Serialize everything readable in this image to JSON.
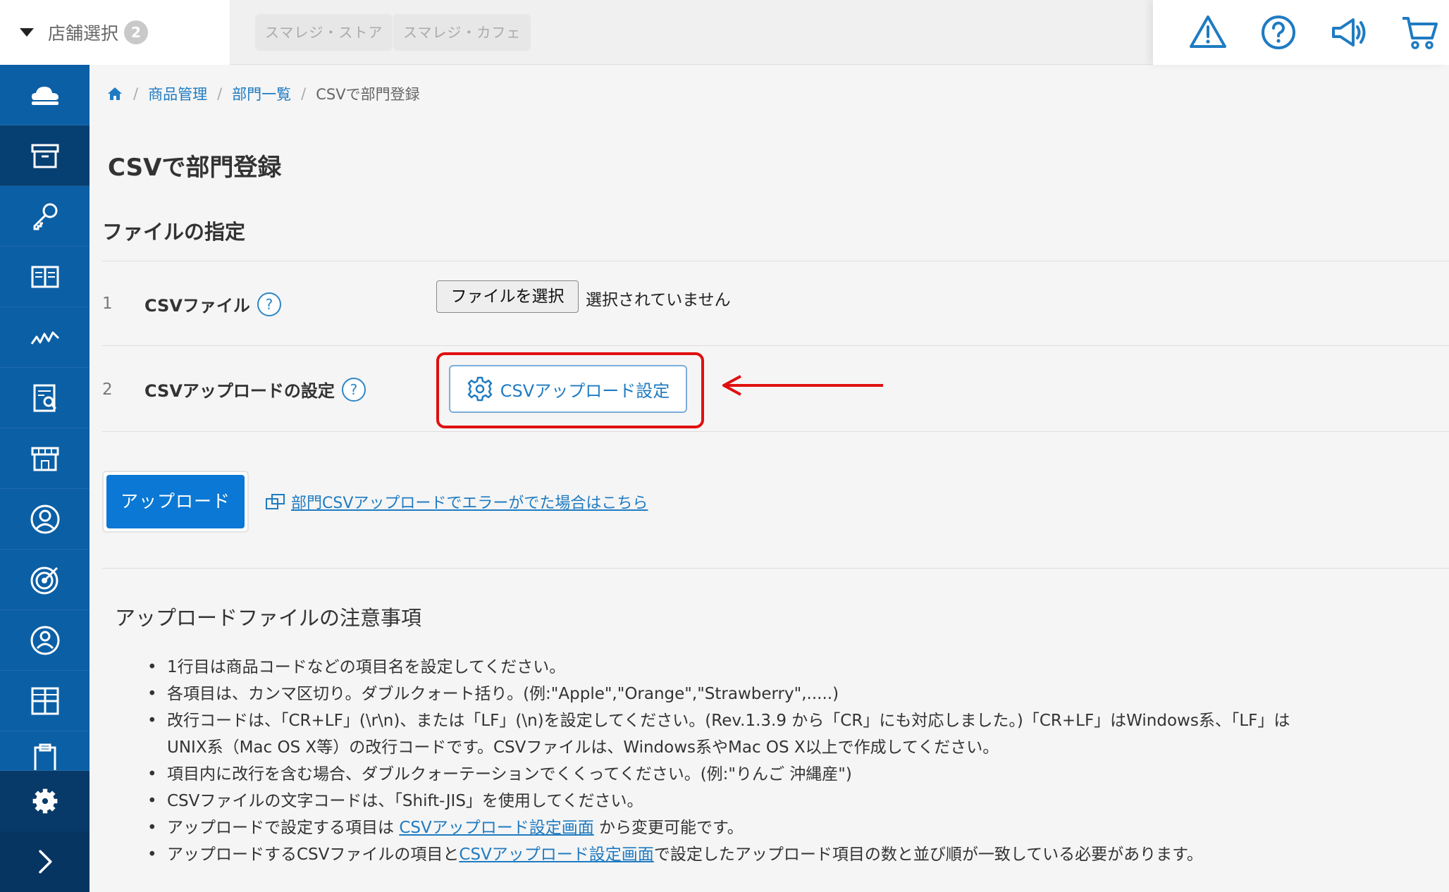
{
  "header": {
    "store_select_label": "店舗選択",
    "store_count": "2",
    "stores": [
      "スマレジ・ストア",
      "スマレジ・カフェ"
    ],
    "icons": [
      "warning-icon",
      "help-icon",
      "megaphone-icon",
      "cart-icon"
    ]
  },
  "sidebar": {
    "items": [
      "cloud-icon",
      "archive-icon",
      "key-icon",
      "book-icon",
      "chart-icon",
      "report-icon",
      "store-icon",
      "user-circle-icon",
      "target-icon",
      "person-icon",
      "grid-icon",
      "clipboard-icon"
    ],
    "active_index": 1,
    "bottom": [
      "gear-icon",
      "chevron-right-icon"
    ]
  },
  "breadcrumb": {
    "items": [
      "商品管理",
      "部門一覧"
    ],
    "current": "CSVで部門登録"
  },
  "page": {
    "title": "CSVで部門登録",
    "section_title": "ファイルの指定"
  },
  "form": {
    "rows": [
      {
        "number": "1",
        "label": "CSVファイル",
        "help": "?"
      },
      {
        "number": "2",
        "label": "CSVアップロードの設定",
        "help": "?"
      }
    ],
    "file_button": "ファイルを選択",
    "file_status": "選択されていません",
    "settings_button": "CSVアップロード設定"
  },
  "actions": {
    "upload_button": "アップロード",
    "error_link": "部門CSVアップロードでエラーがでた場合はこちら"
  },
  "notes": {
    "title": "アップロードファイルの注意事項",
    "items": [
      "1行目は商品コードなどの項目名を設定してください。",
      "各項目は、カンマ区切り。ダブルクォート括り。(例:\"Apple\",\"Orange\",\"Strawberry\",.....)",
      "改行コードは、「CR+LF」(\\r\\n)、または「LF」(\\n)を設定してください。(Rev.1.3.9 から「CR」にも対応しました。)「CR+LF」はWindows系、「LF」は",
      "UNIX系（Mac OS X等）の改行コードです。CSVファイルは、Windows系やMac OS X以上で作成してください。",
      "項目内に改行を含む場合、ダブルクォーテーションでくくってください。(例:\"りんご 沖縄産\")",
      "CSVファイルの文字コードは、「Shift-JIS」を使用してください。"
    ],
    "item7_before": "アップロードで設定する項目は",
    "item7_link": "CSVアップロード設定画面",
    "item7_after": "から変更可能です。",
    "item8_before": "アップロードするCSVファイルの項目と",
    "item8_link": "CSVアップロード設定画面",
    "item8_after": "で設定したアップロード項目の数と並び順が一致している必要があります。"
  },
  "colors": {
    "sidebar": "#0b5fa5",
    "sidebar_active": "#063f72",
    "primary": "#0a78d4",
    "link": "#1f7bc1",
    "highlight": "#e01010"
  }
}
